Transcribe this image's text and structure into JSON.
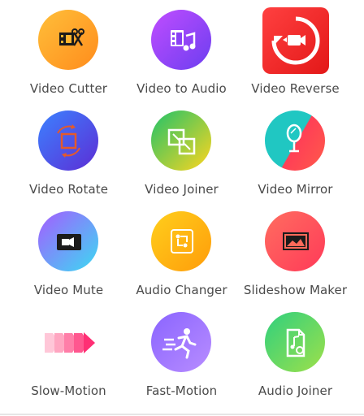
{
  "tools": [
    {
      "label": "Video Cutter",
      "icon": "video-cutter-icon",
      "colors": [
        "#ffb12a",
        "#ff8a1f"
      ]
    },
    {
      "label": "Video to Audio",
      "icon": "video-to-audio-icon",
      "colors": [
        "#b04bff",
        "#7a3cf0"
      ]
    },
    {
      "label": "Video Reverse",
      "icon": "video-reverse-icon",
      "colors": [
        "#ff3b3b",
        "#e01212"
      ]
    },
    {
      "label": "Video Rotate",
      "icon": "video-rotate-icon",
      "colors": [
        "#3a7bff",
        "#5a2bd8"
      ]
    },
    {
      "label": "Video Joiner",
      "icon": "video-joiner-icon",
      "colors": [
        "#27c860",
        "#ffd21f"
      ]
    },
    {
      "label": "Video Mirror",
      "icon": "video-mirror-icon",
      "colors": [
        "#21c6c0",
        "#ff4b5a"
      ]
    },
    {
      "label": "Video Mute",
      "icon": "video-mute-icon",
      "colors": [
        "#9d5bff",
        "#3bd6f5"
      ]
    },
    {
      "label": "Audio Changer",
      "icon": "audio-changer-icon",
      "colors": [
        "#ffcb1a",
        "#ff9f0a"
      ]
    },
    {
      "label": "Slideshow Maker",
      "icon": "slideshow-maker-icon",
      "colors": [
        "#ff6b6b",
        "#ff3a57"
      ]
    },
    {
      "label": "Slow-Motion",
      "icon": "slow-motion-icon",
      "colors": [
        "#ffc9dc",
        "#ff2f7a"
      ]
    },
    {
      "label": "Fast-Motion",
      "icon": "fast-motion-icon",
      "colors": [
        "#8f6bff",
        "#b68cff"
      ]
    },
    {
      "label": "Audio Joiner",
      "icon": "audio-joiner-icon",
      "colors": [
        "#45d57a",
        "#8fdd4a"
      ]
    }
  ]
}
